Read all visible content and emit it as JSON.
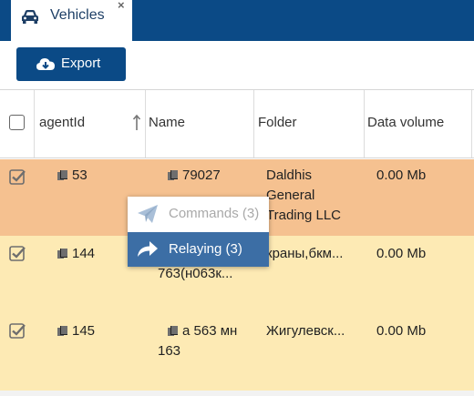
{
  "tab": {
    "title": "Vehicles",
    "close": "×"
  },
  "toolbar": {
    "export_label": "Export"
  },
  "table": {
    "columns": [
      "agentId",
      "Name",
      "Folder",
      "Data volume"
    ],
    "rows": [
      {
        "agentId": "53",
        "name_l1": "79027",
        "name_l2": "",
        "folder_l1": "Daldhis",
        "folder_l2": "General",
        "folder_l3": "Trading LLC",
        "data_volume": "0.00 Mb"
      },
      {
        "agentId": "144",
        "name_l1": "",
        "name_l2": "763(н063к...",
        "folder_l1": "краны,бкм...",
        "folder_l2": "",
        "folder_l3": "",
        "data_volume": "0.00 Mb"
      },
      {
        "agentId": "145",
        "name_l1": "а 563 мн",
        "name_l2": "163",
        "folder_l1": "Жигулевск...",
        "folder_l2": "",
        "folder_l3": "",
        "data_volume": "0.00 Mb"
      }
    ]
  },
  "context_menu": {
    "commands_label": "Commands (3)",
    "relaying_label": "Relaying (3)"
  },
  "colors": {
    "brand": "#0b4a86",
    "row_selected_active": "#f5c190",
    "row_selected": "#fdeab4",
    "menu_active": "#3c6ea5"
  },
  "icons": [
    "car-icon",
    "close-icon",
    "cloud-download-icon",
    "sort-up-icon",
    "copy-icon",
    "paper-plane-icon",
    "share-arrow-icon",
    "checkbox-checked-icon"
  ]
}
